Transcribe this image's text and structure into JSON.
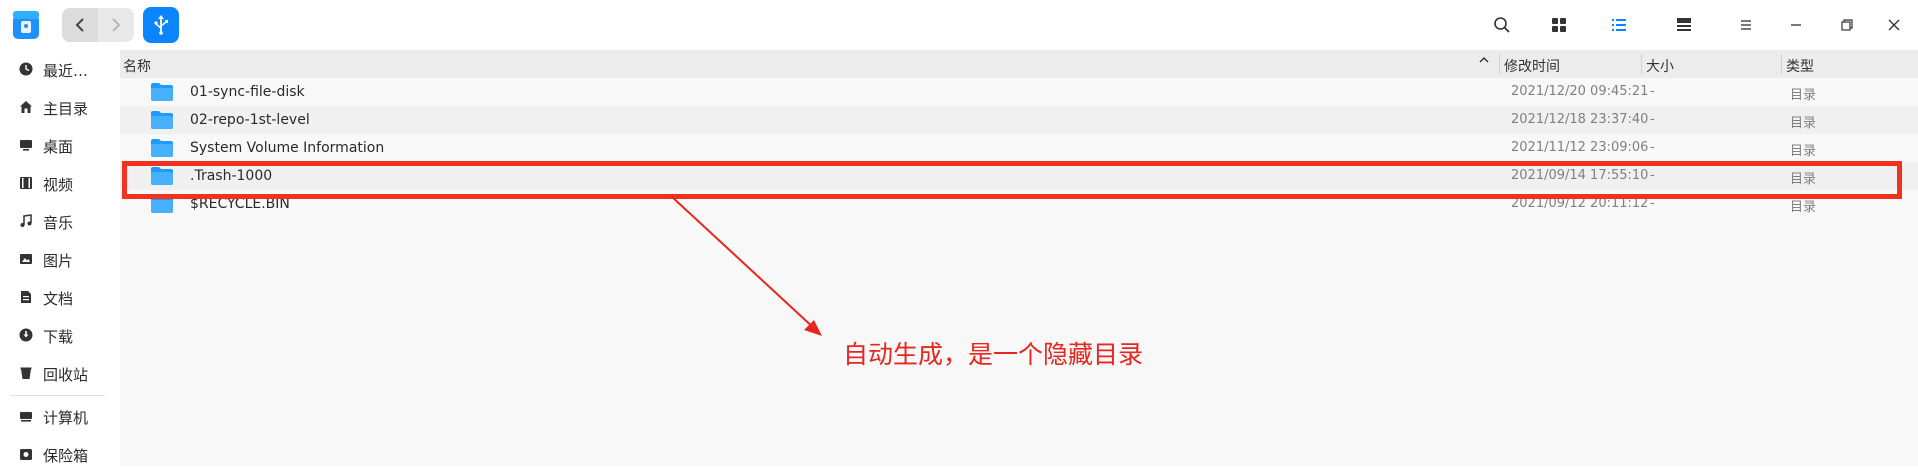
{
  "toolbar": {
    "app_icon": "file-manager-icon",
    "back_icon": "chevron-left-icon",
    "forward_icon": "chevron-right-icon",
    "location_icon": "usb-icon",
    "search_icon": "search-icon",
    "icon_view_icon": "grid-view-icon",
    "list_view_icon": "list-view-icon",
    "detail_view_icon": "detail-view-icon",
    "menu_icon": "menu-icon",
    "minimize_icon": "minimize-icon",
    "restore_icon": "restore-icon",
    "close_icon": "close-icon"
  },
  "sidebar": {
    "items": [
      {
        "label": "最近…",
        "icon": "clock-icon"
      },
      {
        "label": "主目录",
        "icon": "home-icon"
      },
      {
        "label": "桌面",
        "icon": "desktop-icon"
      },
      {
        "label": "视频",
        "icon": "video-icon"
      },
      {
        "label": "音乐",
        "icon": "music-icon"
      },
      {
        "label": "图片",
        "icon": "picture-icon"
      },
      {
        "label": "文档",
        "icon": "document-icon"
      },
      {
        "label": "下载",
        "icon": "download-icon"
      },
      {
        "label": "回收站",
        "icon": "trash-icon"
      },
      {
        "label": "计算机",
        "icon": "computer-icon"
      },
      {
        "label": "保险箱",
        "icon": "vault-icon"
      }
    ]
  },
  "columns": {
    "name": "名称",
    "modified": "修改时间",
    "size": "大小",
    "type": "类型"
  },
  "files": [
    {
      "name": "01-sync-file-disk",
      "modified": "2021/12/20 09:45:21",
      "size": "-",
      "type": "目录"
    },
    {
      "name": "02-repo-1st-level",
      "modified": "2021/12/18 23:37:40",
      "size": "-",
      "type": "目录"
    },
    {
      "name": "System Volume Information",
      "modified": "2021/11/12 23:09:06",
      "size": "-",
      "type": "目录"
    },
    {
      "name": ".Trash-1000",
      "modified": "2021/09/14 17:55:10",
      "size": "-",
      "type": "目录"
    },
    {
      "name": "$RECYCLE.BIN",
      "modified": "2021/09/12 20:11:12",
      "size": "-",
      "type": "目录"
    }
  ],
  "annotation": {
    "text": "自动生成，是一个隐藏目录",
    "color": "#e8261e"
  },
  "colors": {
    "accent": "#0a84ff",
    "folder": "#1e9bff",
    "highlight": "#f0321e"
  }
}
